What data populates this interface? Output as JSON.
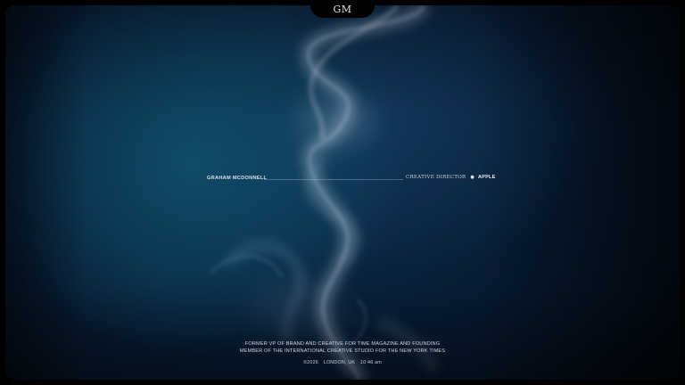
{
  "header": {
    "monogram": "GM"
  },
  "hero": {
    "name": "GRAHAM MCDONNELL",
    "role_title": "CREATIVE DIRECTOR",
    "company_icon": "apple-logo-icon",
    "company": "APPLE"
  },
  "bio": {
    "line1": "FORMER VP OF BRAND AND CREATIVE FOR TIME MAGAZINE AND FOUNDING",
    "line2": "MEMBER OF THE INTERNATIONAL CREATIVE STUDIO FOR THE NEW YORK TIMES"
  },
  "footer": {
    "copyright": "©2026",
    "location": "LONDON, UK",
    "time": "10:46 am"
  },
  "colors": {
    "background_deep": "#071a30",
    "background_glow": "#0f4a66",
    "text": "#d9e1ea"
  }
}
